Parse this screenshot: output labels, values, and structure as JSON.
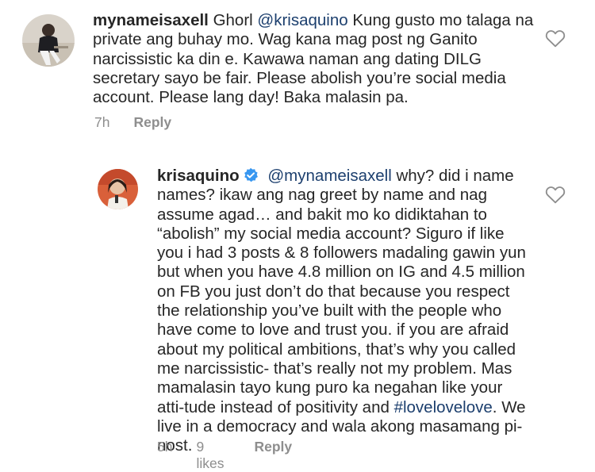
{
  "comments": [
    {
      "username": "mynameisaxell",
      "mention": "@krisaquino",
      "text_before": "Ghorl ",
      "text_after": " Kung gusto mo talaga na private ang buhay mo. Wag kana mag post ng Ganito narcissistic ka din e. Kawawa naman ang dating DILG secretary sayo be fair. Please abolish you’re social media account. Please lang day! Baka malasin pa.",
      "time": "7h",
      "reply_label": "Reply"
    },
    {
      "username": "krisaquino",
      "verified": true,
      "mention": "@mynameisaxell",
      "text_after": " why? did i name names? ikaw ang nag greet by name and nag assume agad… and bakit mo ko didiktahan to “abolish” my social media account? Siguro if like you i had 3 posts & 8 followers madaling gawin yun but when you have 4.8 million on IG and 4.5 million on FB you just don’t do that because you respect the relationship you’ve built with the people who have come to love and trust you. if you are afraid about my political ambitions, that’s why you called me narcissistic- that’s really not my problem. Mas mamalasin tayo kung puro ka negahan like your atti-tude instead of positivity and ",
      "hashtag": "#lovelovelove",
      "text_end": ". We live in a democracy and wala akong masamang pi-nost.",
      "time": "5h",
      "likes": "9 likes",
      "reply_label": "Reply"
    }
  ],
  "icons": {
    "like": "heart-outline-icon",
    "verified": "verified-badge-icon"
  },
  "colors": {
    "text": "#262626",
    "muted": "#8e8e8e",
    "link": "#1c3f6e",
    "verified": "#3897f0"
  }
}
